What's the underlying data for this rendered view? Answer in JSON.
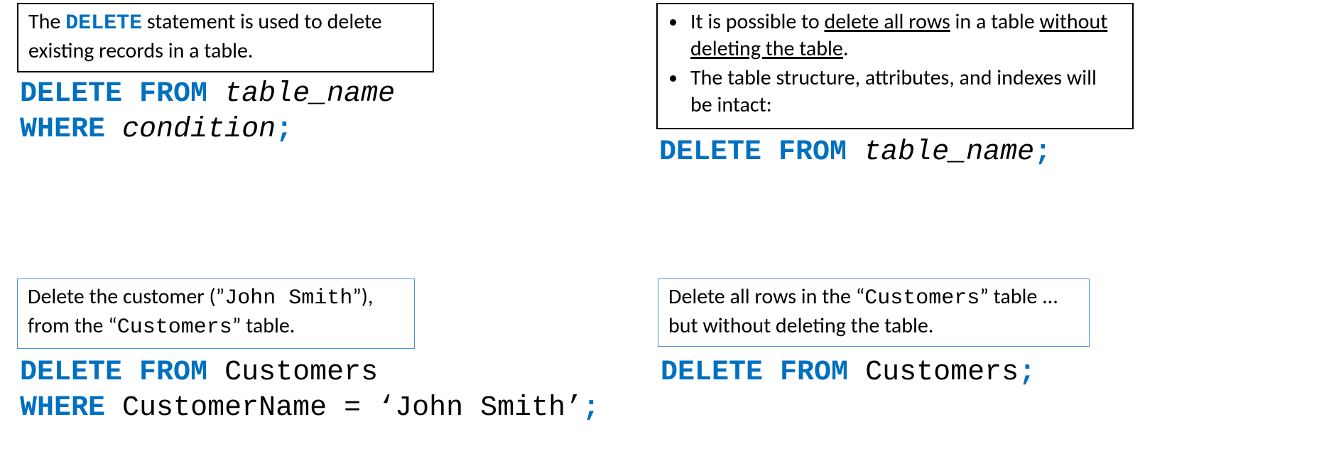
{
  "intro": {
    "pre": "The ",
    "keyword": "DELETE",
    "post": " statement is used to delete existing records in a table."
  },
  "syntax1": {
    "deleteFrom": "DELETE FROM",
    "table": "table_name",
    "where": "WHERE",
    "condition": "condition",
    "semi": ";"
  },
  "notes": {
    "b1_pre": "It is possible to ",
    "b1_u1": "delete all rows",
    "b1_mid": " in a table ",
    "b1_u2": "without deleting the table",
    "b1_post": ".",
    "b2": "The table structure, attributes, and indexes will be intact:"
  },
  "syntax2": {
    "deleteFrom": "DELETE FROM",
    "table": "table_name",
    "semi": ";"
  },
  "task1": {
    "pre": "Delete the customer (",
    "name_q1": "”",
    "name": "John Smith",
    "name_q2": "”",
    "mid": "), from the ",
    "tbl_q1": "“",
    "tbl": "Customers",
    "tbl_q2": "”",
    "post": "  table."
  },
  "task2": {
    "pre": "Delete all rows in the ",
    "tbl_q1": "“",
    "tbl": "Customers",
    "tbl_q2": "”",
    "post": " table ... but without deleting the table."
  },
  "example1": {
    "deleteFrom": "DELETE FROM",
    "table": "Customers",
    "where": "WHERE",
    "colExpr": "CustomerName = ‘John Smith’",
    "semi": ";"
  },
  "example2": {
    "deleteFrom": "DELETE FROM",
    "table": "Customers",
    "semi": ";"
  }
}
